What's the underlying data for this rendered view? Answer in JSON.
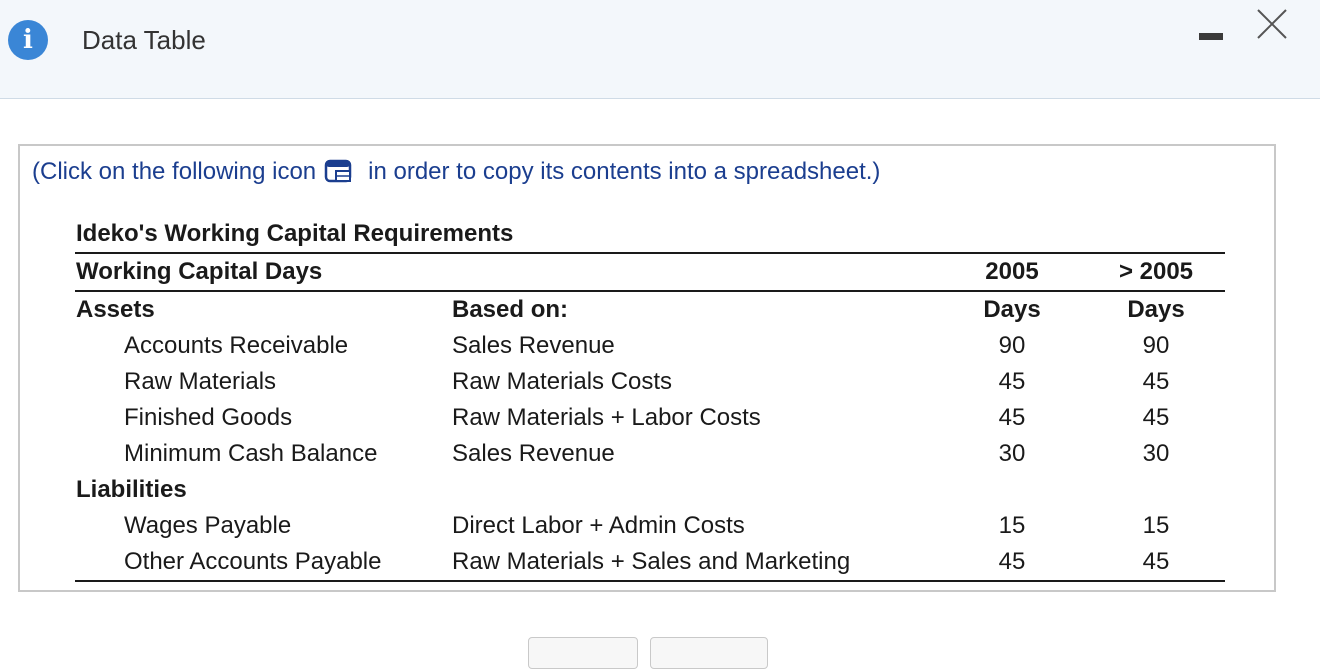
{
  "window": {
    "title": "Data Table",
    "icons": {
      "info": "info-icon",
      "minimize": "minimize-icon",
      "close": "close-icon",
      "copy": "spreadsheet-copy-icon"
    }
  },
  "instruction": {
    "before": "(Click on the following icon",
    "after": "in order to copy its contents into a spreadsheet.)"
  },
  "table": {
    "title": "Ideko's Working Capital Requirements",
    "header": {
      "label": "Working Capital Days",
      "col2005": "2005",
      "colAfter": "> 2005"
    },
    "subheader": {
      "section": "Assets",
      "based": "Based on:",
      "days2005": "Days",
      "daysAfter": "Days"
    },
    "assets": [
      {
        "item": "Accounts Receivable",
        "based": "Sales Revenue",
        "v2005": "90",
        "vAfter": "90"
      },
      {
        "item": "Raw Materials",
        "based": "Raw Materials Costs",
        "v2005": "45",
        "vAfter": "45"
      },
      {
        "item": "Finished Goods",
        "based": "Raw Materials + Labor Costs",
        "v2005": "45",
        "vAfter": "45"
      },
      {
        "item": "Minimum Cash Balance",
        "based": "Sales Revenue",
        "v2005": "30",
        "vAfter": "30"
      }
    ],
    "liabilities_label": "Liabilities",
    "liabilities": [
      {
        "item": "Wages Payable",
        "based": "Direct Labor + Admin Costs",
        "v2005": "15",
        "vAfter": "15"
      },
      {
        "item": "Other Accounts Payable",
        "based": "Raw Materials + Sales and Marketing",
        "v2005": "45",
        "vAfter": "45"
      }
    ]
  },
  "colors": {
    "accent": "#3a86d6",
    "link": "#1b3e8f",
    "titlebar": "#f3f7fb"
  }
}
